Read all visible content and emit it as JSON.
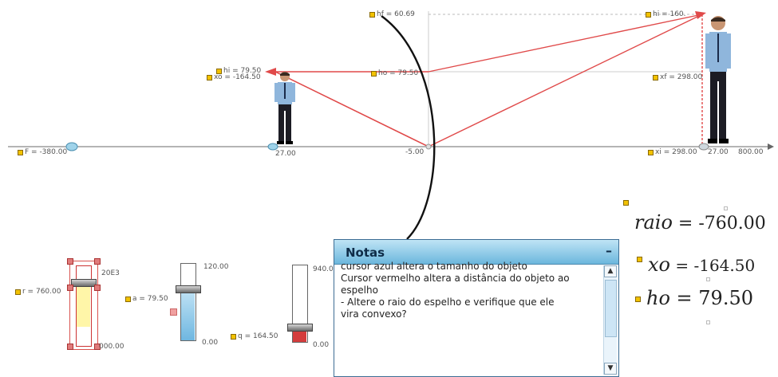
{
  "labels": {
    "hf": "hf = 60.69",
    "hi": "hi = 160.",
    "hi_left": "hi = 79.50",
    "xo_left": "xo = -164.50",
    "ho_center": "ho = 79.50",
    "xf_right": "xf = 298.00",
    "xi_right": "xi = 298.00",
    "F": "F = -380.00",
    "tick_27_left": "27.00",
    "tick_center": "-5.00",
    "tick_27_right": "27.00",
    "tick_800": "800.00"
  },
  "formulas": {
    "raio_var": "raio",
    "raio_val": " = -760.00",
    "xo_var": "xo",
    "xo_val": " = -164.50",
    "ho_var": "ho",
    "ho_val": " = 79.50"
  },
  "sliders": {
    "r": {
      "label": "r = 760.00",
      "max": "20E3",
      "min": "000.00"
    },
    "a": {
      "label": "a = 79.50",
      "max": "120.00",
      "min": "0.00",
      "value_fraction": 0.66
    },
    "q": {
      "label": "q = 164.50",
      "max": "940.00",
      "min": "0.00",
      "value_fraction": 0.17
    }
  },
  "notes": {
    "title": "Notas",
    "minimize": "–",
    "lines": [
      "cursor azul altera o tamanho do objeto",
      "Cursor vermelho altera a distância do objeto ao",
      "espelho",
      "- Altere o raio do espelho e verifique que ele",
      "vira convexo?"
    ],
    "scroll_up": "▲",
    "scroll_down": "▼"
  },
  "colors": {
    "ray": "#e04a4a",
    "axis": "#888888",
    "mirror": "#111111",
    "point": "#f2c200",
    "slider_blue": "#86c6e8",
    "slider_red": "#d43c3c"
  }
}
